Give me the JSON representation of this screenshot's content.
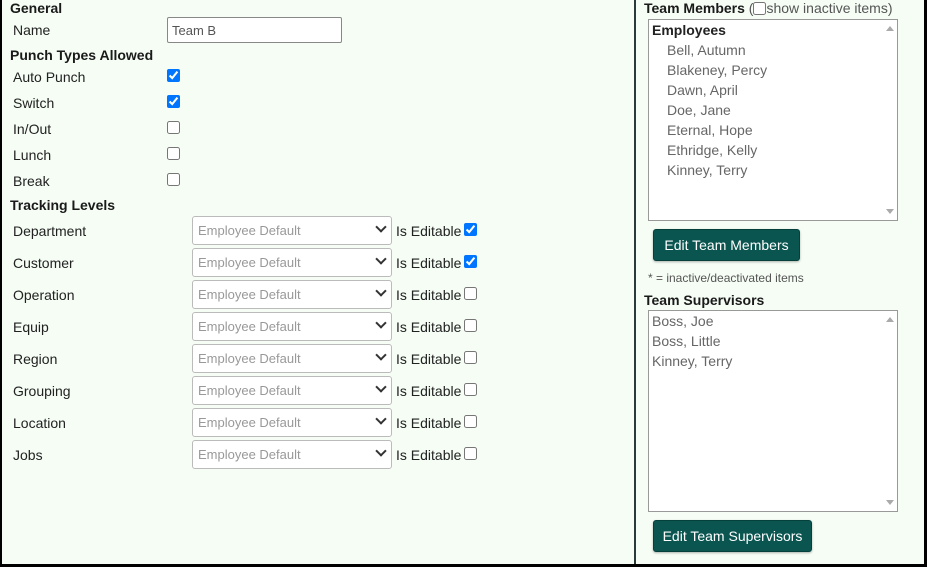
{
  "general": {
    "title": "General",
    "name_label": "Name",
    "name_value": "Team B"
  },
  "punch_types": {
    "title": "Punch Types Allowed",
    "items": [
      {
        "label": "Auto Punch",
        "checked": true
      },
      {
        "label": "Switch",
        "checked": true
      },
      {
        "label": "In/Out",
        "checked": false
      },
      {
        "label": "Lunch",
        "checked": false
      },
      {
        "label": "Break",
        "checked": false
      }
    ]
  },
  "tracking": {
    "title": "Tracking Levels",
    "editable_label": "Is Editable",
    "rows": [
      {
        "label": "Department",
        "value": "Employee Default",
        "editable": true
      },
      {
        "label": "Customer",
        "value": "Employee Default",
        "editable": true
      },
      {
        "label": "Operation",
        "value": "Employee Default",
        "editable": false
      },
      {
        "label": "Equip",
        "value": "Employee Default",
        "editable": false
      },
      {
        "label": "Region",
        "value": "Employee Default",
        "editable": false
      },
      {
        "label": "Grouping",
        "value": "Employee Default",
        "editable": false
      },
      {
        "label": "Location",
        "value": "Employee Default",
        "editable": false
      },
      {
        "label": "Jobs",
        "value": "Employee Default",
        "editable": false
      }
    ]
  },
  "team_members": {
    "title": "Team Members",
    "paren_open": "(",
    "paren_close": ")",
    "show_inactive_label": "show inactive items",
    "show_inactive_checked": false,
    "group_label": "Employees",
    "members": [
      "Bell, Autumn",
      "Blakeney, Percy",
      "Dawn, April",
      "Doe, Jane",
      "Eternal, Hope",
      "Ethridge, Kelly",
      "Kinney, Terry"
    ],
    "edit_button": "Edit Team Members",
    "note": "* = inactive/deactivated items"
  },
  "team_supervisors": {
    "title": "Team Supervisors",
    "supervisors": [
      "Boss, Joe",
      "Boss, Little",
      "Kinney, Terry"
    ],
    "edit_button": "Edit Team Supervisors"
  },
  "colors": {
    "background": "#f5fdf5",
    "button": "#0a5550",
    "checkbox_accent": "#0075ff"
  },
  "icons": {
    "select_arrow": "chevron-down-icon",
    "scroll_up": "scroll-up-arrow-icon",
    "scroll_down": "scroll-down-arrow-icon"
  }
}
